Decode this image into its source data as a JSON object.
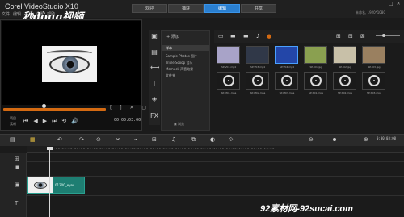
{
  "app": {
    "title": "Corel VideoStudio",
    "title_suffix": "X10",
    "menu": [
      "文件",
      "编辑",
      "工具",
      "设置",
      "帮助"
    ],
    "tabs": [
      "欢迎",
      "捕获",
      "编辑",
      "共享"
    ],
    "active_tab": "编辑",
    "window_controls": [
      "_",
      "□",
      "✕"
    ],
    "project_info": "未命名, 1920*1080"
  },
  "watermark": {
    "logo_text": "秒dòng视频",
    "site_text": "92素材网-92sucai.com"
  },
  "player": {
    "mode_labels": [
      "项目",
      "素材"
    ],
    "transport": [
      "⏮",
      "◀",
      "▶",
      "⏭",
      "⟲",
      "🔊"
    ],
    "timecode": "00:00:03:00",
    "trim_markers": "[ ] ✕ ▢"
  },
  "library": {
    "add_label": "+ 添加",
    "folders": [
      "样本",
      "Sample Photos 图片",
      "Triple Scoop 音乐",
      "Mamuck 声音效果",
      "文件夹"
    ],
    "selected_folder": "样本",
    "browse_label": "▣ 浏览",
    "sidebar_icons": [
      "media-icon",
      "instant-project-icon",
      "transition-icon",
      "title-icon",
      "graphic-icon",
      "filter-icon"
    ],
    "sidebar_glyphs": [
      "▣",
      "▤",
      "⟷",
      "T",
      "◈",
      "FX"
    ],
    "toolbar_glyphs": [
      "▭",
      "▬",
      "▬",
      "♪",
      "●",
      "⊞",
      "⊟",
      "⊠"
    ],
    "thumbnails": [
      {
        "label": "SP-V02.mp4",
        "kind": "video",
        "color": "#a8a3c8"
      },
      {
        "label": "SP-V03.mp4",
        "kind": "video",
        "color": "#303848"
      },
      {
        "label": "SP-V04.mp4",
        "kind": "video",
        "color": "#2346a8"
      },
      {
        "label": "SP-I01.jpg",
        "kind": "image",
        "color": "#8aa050"
      },
      {
        "label": "SP-I02.jpg",
        "kind": "image",
        "color": "#c8c0a8"
      },
      {
        "label": "SP-I03.jpg",
        "kind": "image",
        "color": "#9a8060"
      },
      {
        "label": "SP-M01.mpa",
        "kind": "audio",
        "color": "#1a1a1a"
      },
      {
        "label": "SP-M02.mpa",
        "kind": "audio",
        "color": "#1a1a1a"
      },
      {
        "label": "SP-M03.mpa",
        "kind": "audio",
        "color": "#1a1a1a"
      },
      {
        "label": "SP-S01.mpa",
        "kind": "audio",
        "color": "#1a1a1a"
      },
      {
        "label": "SP-S02.mpa",
        "kind": "audio",
        "color": "#1a1a1a"
      },
      {
        "label": "SP-S03.mpa",
        "kind": "audio",
        "color": "#1a1a1a"
      }
    ]
  },
  "timeline": {
    "toolbar_glyphs": [
      "▤",
      "▦",
      "↶",
      "↷",
      "⊙",
      "✂",
      "⌁",
      "⊞",
      "♫",
      "⧉",
      "◐",
      "⟐"
    ],
    "timecode": "0:00:03:00",
    "zoom_minus": "⊖",
    "zoom_plus": "⊕",
    "ruler": "00:00:00:00     00:00:02:00     00:00:04:00     00:00:06:00     00:00:08:00     00:00:10:00     00:00:12:00     00:00:14:00     00:00:16:00",
    "track_icons": [
      "⊞",
      "▣",
      "▣",
      "T"
    ],
    "clip_label": "01200_eyes"
  }
}
